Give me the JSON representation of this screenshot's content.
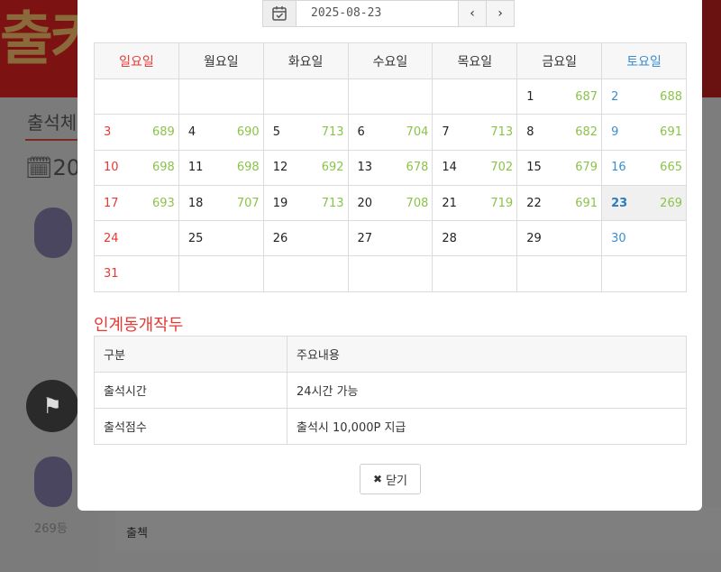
{
  "background": {
    "logo_text": "출키",
    "section_title": "출석체",
    "calendar_heading_fragment": "20",
    "rank_text": "269등",
    "row_text": "출첵"
  },
  "datepicker": {
    "value": "2025-08-23",
    "prev_label": "‹",
    "next_label": "›"
  },
  "calendar": {
    "weekdays": [
      "일요일",
      "월요일",
      "화요일",
      "수요일",
      "목요일",
      "금요일",
      "토요일"
    ],
    "weeks": [
      [
        {
          "d": "",
          "c": ""
        },
        {
          "d": "",
          "c": ""
        },
        {
          "d": "",
          "c": ""
        },
        {
          "d": "",
          "c": ""
        },
        {
          "d": "",
          "c": ""
        },
        {
          "d": "1",
          "c": "687"
        },
        {
          "d": "2",
          "c": "688"
        }
      ],
      [
        {
          "d": "3",
          "c": "689"
        },
        {
          "d": "4",
          "c": "690"
        },
        {
          "d": "5",
          "c": "713"
        },
        {
          "d": "6",
          "c": "704"
        },
        {
          "d": "7",
          "c": "713"
        },
        {
          "d": "8",
          "c": "682"
        },
        {
          "d": "9",
          "c": "691"
        }
      ],
      [
        {
          "d": "10",
          "c": "698"
        },
        {
          "d": "11",
          "c": "698"
        },
        {
          "d": "12",
          "c": "692"
        },
        {
          "d": "13",
          "c": "678"
        },
        {
          "d": "14",
          "c": "702"
        },
        {
          "d": "15",
          "c": "679"
        },
        {
          "d": "16",
          "c": "665"
        }
      ],
      [
        {
          "d": "17",
          "c": "693"
        },
        {
          "d": "18",
          "c": "707"
        },
        {
          "d": "19",
          "c": "713"
        },
        {
          "d": "20",
          "c": "708"
        },
        {
          "d": "21",
          "c": "719"
        },
        {
          "d": "22",
          "c": "691"
        },
        {
          "d": "23",
          "c": "269",
          "today": true
        }
      ],
      [
        {
          "d": "24",
          "c": ""
        },
        {
          "d": "25",
          "c": ""
        },
        {
          "d": "26",
          "c": ""
        },
        {
          "d": "27",
          "c": ""
        },
        {
          "d": "28",
          "c": ""
        },
        {
          "d": "29",
          "c": ""
        },
        {
          "d": "30",
          "c": ""
        }
      ],
      [
        {
          "d": "31",
          "c": ""
        },
        {
          "d": "",
          "c": ""
        },
        {
          "d": "",
          "c": ""
        },
        {
          "d": "",
          "c": ""
        },
        {
          "d": "",
          "c": ""
        },
        {
          "d": "",
          "c": ""
        },
        {
          "d": "",
          "c": ""
        }
      ]
    ]
  },
  "info": {
    "title": "인계동개작두",
    "headers": [
      "구분",
      "주요내용"
    ],
    "rows": [
      [
        "출석시간",
        "24시간 가능"
      ],
      [
        "출석점수",
        "출석시 10,000P 지급"
      ]
    ]
  },
  "close_button": {
    "label": "닫기"
  },
  "colors": {
    "sunday": "#e53935",
    "saturday": "#3a8ed0",
    "count": "#8bc34a",
    "title": "#e53935"
  }
}
